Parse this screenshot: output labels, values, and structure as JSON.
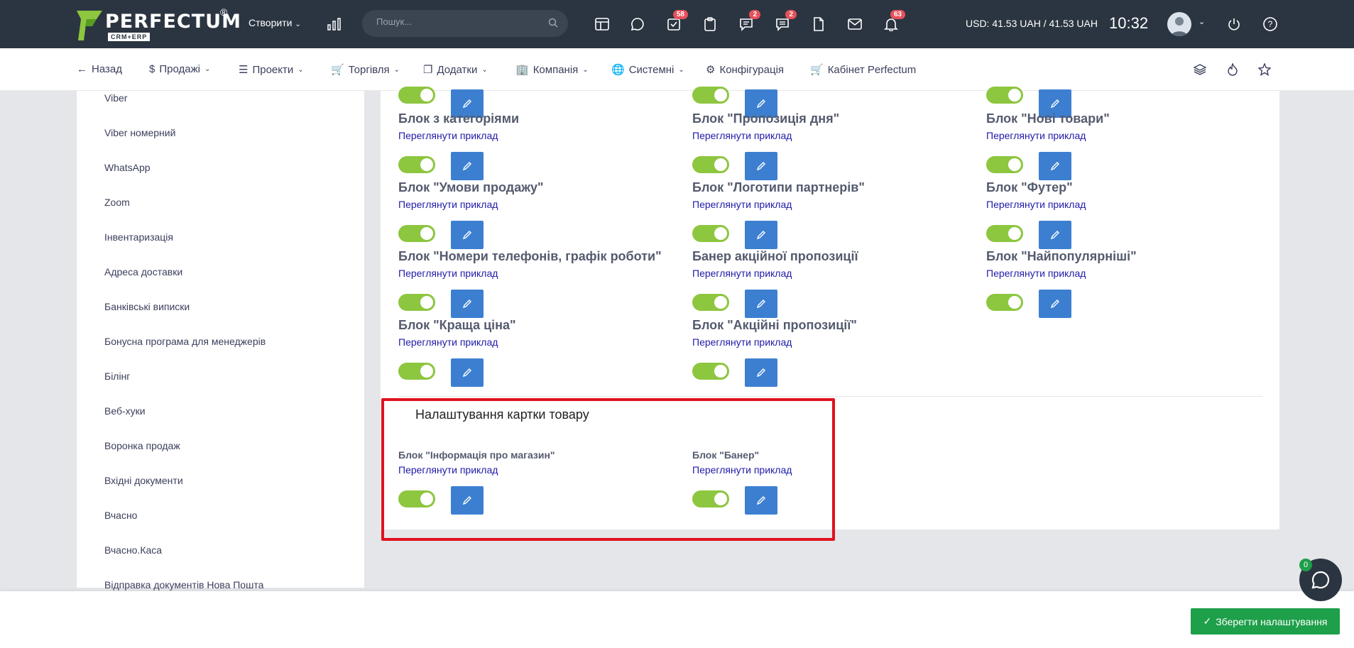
{
  "header": {
    "logo_text": "PERFECTUM",
    "logo_reg": "®",
    "logo_sub": "CRM+ERP",
    "create_label": "Створити",
    "search_placeholder": "Пошук...",
    "badges": {
      "tasks": "58",
      "chat": "2",
      "messages": "2",
      "notifications": "63"
    },
    "currency": "USD: 41.53 UAH / 41.53 UAH",
    "clock": "10:32"
  },
  "nav": {
    "back": "Назад",
    "sales": "Продажі",
    "projects": "Проекти",
    "trade": "Торгівля",
    "addons": "Додатки",
    "company": "Компанія",
    "system": "Системні",
    "config": "Конфігурація",
    "cabinet": "Кабінет Perfectum"
  },
  "sidebar": {
    "items": [
      "Viber",
      "Viber номерний",
      "WhatsApp",
      "Zoom",
      "Інвентаризація",
      "Адреса доставки",
      "Банківські виписки",
      "Бонусна програма для менеджерів",
      "Білінг",
      "Веб-хуки",
      "Воронка продаж",
      "Вхідні документи",
      "Вчасно",
      "Вчасно.Каса",
      "Відправка документів Нова Пошта"
    ]
  },
  "blocks": {
    "link_label": "Переглянути приклад",
    "rows": [
      [
        "Блок з категоріями",
        "Блок \"Пропозиція дня\"",
        "Блок \"Нові товари\""
      ],
      [
        "Блок \"Умови продажу\"",
        "Блок \"Логотипи партнерів\"",
        "Блок \"Футер\""
      ],
      [
        "Блок \"Номери телефонів, графік роботи\"",
        "Банер акційної пропозиції",
        "Блок \"Найпопулярніші\""
      ],
      [
        "Блок \"Краща ціна\"",
        "Блок \"Акційні пропозиції\""
      ]
    ]
  },
  "product_card": {
    "title": "Налаштування картки товару",
    "items": [
      "Блок \"Інформація про магазин\"",
      "Блок \"Банер\""
    ]
  },
  "footer": {
    "save_label": "Зберегти налаштування",
    "chat_badge": "0"
  },
  "colors": {
    "topbar": "#2b3541",
    "toggle_on": "#8dc63f",
    "edit_button": "#3c7fd1",
    "save_button": "#1e9f4a",
    "highlight": "#e1121f",
    "link": "#1f1aa8"
  }
}
